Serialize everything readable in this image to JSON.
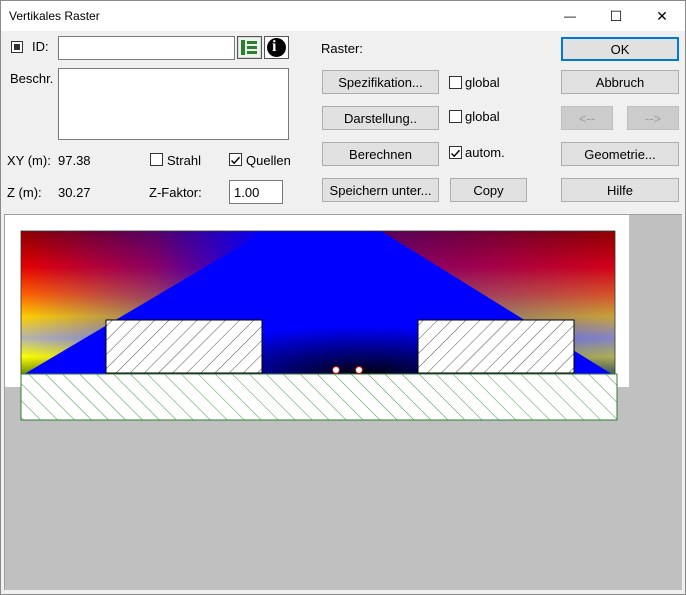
{
  "window": {
    "title": "Vertikales Raster"
  },
  "title_controls": {
    "minimize": "—",
    "maximize": "☐",
    "close": "✕"
  },
  "id_field": {
    "label": "ID:",
    "value": ""
  },
  "description": {
    "label": "Beschr.",
    "value": ""
  },
  "coords": {
    "xy_label": "XY (m):",
    "xy_value": "97.38",
    "z_label": "Z (m):",
    "z_value": "30.27"
  },
  "options": {
    "strahl_label": "Strahl",
    "strahl_checked": false,
    "quellen_label": "Quellen",
    "quellen_checked": true
  },
  "zfaktor": {
    "label": "Z-Faktor:",
    "value": "1.00"
  },
  "raster": {
    "label": "Raster:",
    "spezifikation": "Spezifikation...",
    "darstellung": "Darstellung..",
    "berechnen": "Berechnen",
    "speichern": "Speichern unter...",
    "copy": "Copy",
    "global1": "global",
    "global2": "global",
    "autom": "autom.",
    "global1_checked": false,
    "global2_checked": false,
    "autom_checked": true
  },
  "actions": {
    "ok": "OK",
    "abbruch": "Abbruch",
    "prev": "<--",
    "next": "-->",
    "geometrie": "Geometrie...",
    "hilfe": "Hilfe"
  },
  "icons": {
    "tree": "tree-icon",
    "info": "info-icon",
    "info_glyph": "i"
  },
  "colors": {
    "accent": "#0078d7",
    "ground_hatch": "#2e8b2e",
    "button_face": "#e1e1e1"
  }
}
